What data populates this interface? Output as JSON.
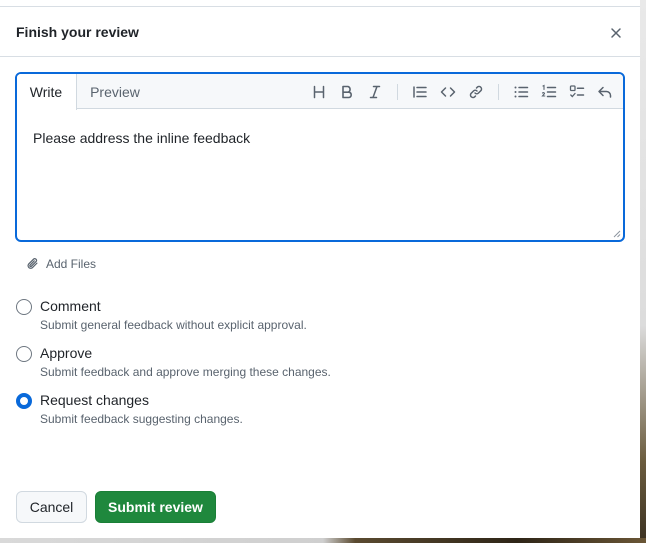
{
  "dialog": {
    "title": "Finish your review",
    "close_icon": "close-icon"
  },
  "editor": {
    "tabs": [
      {
        "label": "Write",
        "active": true
      },
      {
        "label": "Preview",
        "active": false
      }
    ],
    "toolbar_icons": [
      "heading-icon",
      "bold-icon",
      "italic-icon",
      "quote-icon",
      "code-icon",
      "link-icon",
      "unordered-list-icon",
      "ordered-list-icon",
      "task-list-icon",
      "reply-icon"
    ],
    "value": "Please address the inline feedback"
  },
  "attachments": {
    "label": "Add Files",
    "icon": "paperclip-icon"
  },
  "review_options": [
    {
      "label": "Comment",
      "description": "Submit general feedback without explicit approval.",
      "checked": false
    },
    {
      "label": "Approve",
      "description": "Submit feedback and approve merging these changes.",
      "checked": false
    },
    {
      "label": "Request changes",
      "description": "Submit feedback suggesting changes.",
      "checked": true
    }
  ],
  "actions": {
    "cancel_label": "Cancel",
    "submit_label": "Submit review"
  },
  "colors": {
    "accent": "#0969da",
    "primary_button": "#1f883d",
    "muted_text": "#59636e"
  }
}
